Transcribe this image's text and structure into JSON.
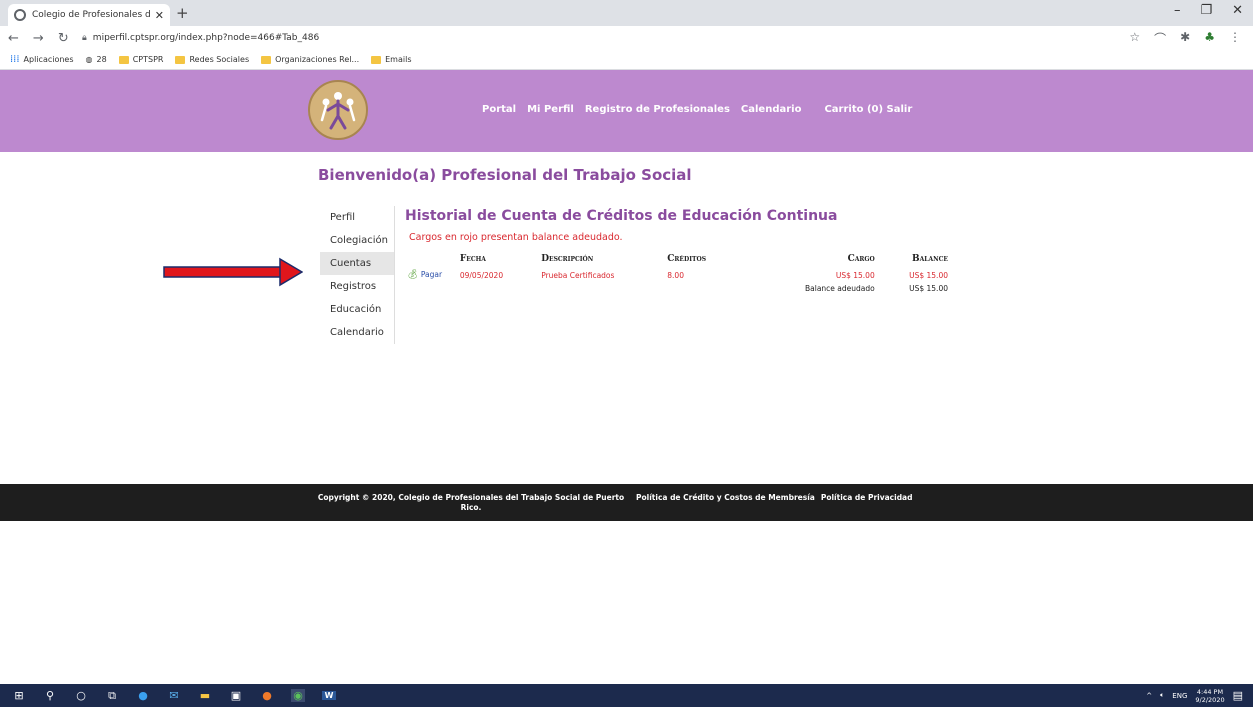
{
  "browser": {
    "tab_title": "Colegio de Profesionales del Tra",
    "tab_close": "✕",
    "new_tab": "+",
    "url": "miperfil.cptspr.org/index.php?node=466#Tab_486",
    "window_controls": [
      "–",
      "❐",
      "✕"
    ],
    "bookmarks": [
      {
        "label": "Aplicaciones",
        "type": "apps"
      },
      {
        "label": "28",
        "type": "site"
      },
      {
        "label": "CPTSPR",
        "type": "folder"
      },
      {
        "label": "Redes Sociales",
        "type": "folder"
      },
      {
        "label": "Organizaciones Rel...",
        "type": "folder"
      },
      {
        "label": "Emails",
        "type": "folder"
      }
    ]
  },
  "header": {
    "nav": [
      "Portal",
      "Mi Perfil",
      "Registro de Profesionales",
      "Calendario",
      "Carrito (0) Salir"
    ]
  },
  "welcome": "Bienvenido(a) Profesional del Trabajo Social",
  "sidebar": {
    "items": [
      "Perfil",
      "Colegiación",
      "Cuentas",
      "Registros",
      "Educación",
      "Calendario"
    ],
    "active": "Cuentas"
  },
  "account": {
    "title": "Historial de Cuenta de Créditos de Educación Continua",
    "notice": "Cargos en rojo presentan balance adeudado.",
    "columns": [
      "Fecha",
      "Descripción",
      "Créditos",
      "Cargo",
      "Balance"
    ],
    "rows": [
      {
        "action": "Pagar",
        "fecha": "09/05/2020",
        "descripcion": "Prueba Certificados",
        "creditos": "8.00",
        "cargo": "US$ 15.00",
        "balance": "US$ 15.00"
      }
    ],
    "total_label": "Balance adeudado",
    "total_value": "US$ 15.00"
  },
  "footer": {
    "copyright": "Copyright © 2020, Colegio de Profesionales del Trabajo Social de Puerto Rico.",
    "links": [
      "Política de Crédito y Costos de Membresía",
      "Política de Privacidad"
    ]
  },
  "taskbar": {
    "tray_lang": "ENG",
    "time": "4:44 PM",
    "date": "9/2/2020"
  },
  "colors": {
    "header_bg": "#bd89cf",
    "accent_purple": "#8a4c9e",
    "alert_red": "#d9282f",
    "footer_bg": "#1e1e1e"
  }
}
